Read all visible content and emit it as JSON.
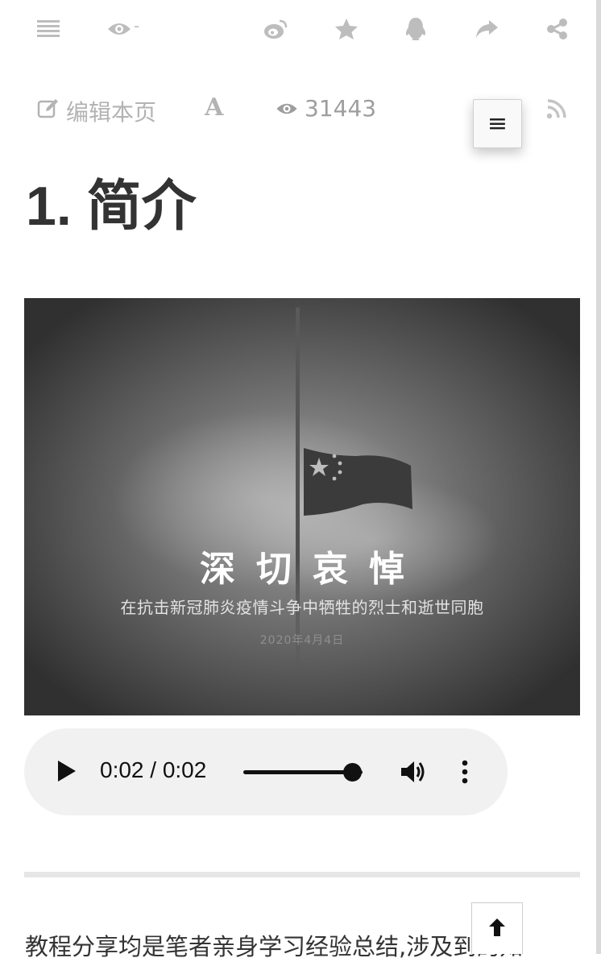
{
  "toolbar": {
    "views_suffix": "-",
    "icons": [
      "list-icon",
      "eye-icon",
      "weibo-icon",
      "star-icon",
      "qq-icon",
      "share-forward-icon",
      "share-nodes-icon"
    ]
  },
  "page_meta": {
    "edit_label": "编辑本页",
    "font_icon_glyph": "A",
    "view_count": "31443"
  },
  "menu_button": {
    "glyph": "≡"
  },
  "article": {
    "title": "1. 简介",
    "banner": {
      "headline": "深切哀悼",
      "subline": "在抗击新冠肺炎疫情斗争中牺牲的烈士和逝世同胞",
      "date": "2020年4月4日"
    },
    "audio": {
      "time_display": "0:02 / 0:02",
      "progress": 1.0
    },
    "paragraph_start": "教程分享均是笔者亲身学习经验总结,涉及到的知"
  },
  "colors": {
    "icon_gray": "#bdbdbd",
    "text": "#333333",
    "player_bg": "#f1f1f1"
  }
}
